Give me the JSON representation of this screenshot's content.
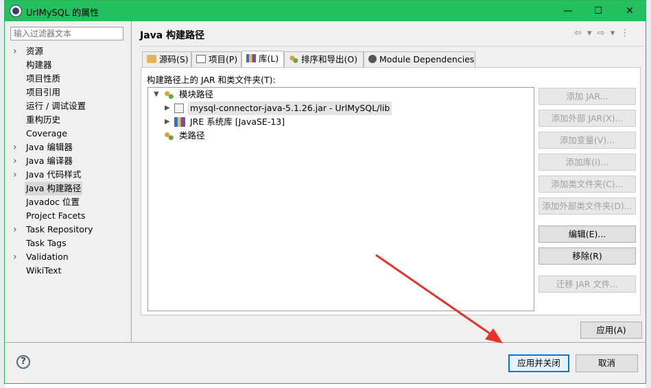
{
  "window": {
    "title": "UrlMySQL 的属性",
    "controls": [
      "—",
      "☐",
      "✕"
    ]
  },
  "filter": {
    "placeholder": "输入过滤器文本"
  },
  "sidebar": {
    "items": [
      {
        "label": "资源",
        "expandable": true
      },
      {
        "label": "构建器",
        "expandable": false
      },
      {
        "label": "项目性质",
        "expandable": false
      },
      {
        "label": "项目引用",
        "expandable": false
      },
      {
        "label": "运行 / 调试设置",
        "expandable": false
      },
      {
        "label": "重构历史",
        "expandable": false
      },
      {
        "label": "Coverage",
        "expandable": false
      },
      {
        "label": "Java 编辑器",
        "expandable": true
      },
      {
        "label": "Java 编译器",
        "expandable": true
      },
      {
        "label": "Java 代码样式",
        "expandable": true
      },
      {
        "label": "Java 构建路径",
        "expandable": false,
        "selected": true
      },
      {
        "label": "Javadoc 位置",
        "expandable": false
      },
      {
        "label": "Project Facets",
        "expandable": false
      },
      {
        "label": "Task Repository",
        "expandable": true
      },
      {
        "label": "Task Tags",
        "expandable": false
      },
      {
        "label": "Validation",
        "expandable": true
      },
      {
        "label": "WikiText",
        "expandable": false
      }
    ]
  },
  "page": {
    "title": "Java 构建路径",
    "nav": "⇦ ▾ ⇨ ▾ ⋮"
  },
  "tabs": [
    {
      "label": "源码(S)",
      "icon": "source-folder-icon"
    },
    {
      "label": "项目(P)",
      "icon": "project-icon"
    },
    {
      "label": "库(L)",
      "icon": "library-icon",
      "active": true
    },
    {
      "label": "排序和导出(O)",
      "icon": "order-export-icon"
    },
    {
      "label": "Module Dependencies",
      "icon": "module-icon"
    }
  ],
  "libraries": {
    "label": "构建路径上的 JAR 和类文件夹(T):",
    "tree": {
      "modulepath": "模块路径",
      "jar": "mysql-connector-java-5.1.26.jar  -  UrlMySQL/lib",
      "jre": "JRE 系统库 [JavaSE-13]",
      "classpath": "类路径"
    }
  },
  "buttons": {
    "add_jar": "添加 JAR...",
    "add_external_jar": "添加外部 JAR(X)...",
    "add_variable": "添加变量(V)...",
    "add_library": "添加库(i)...",
    "add_class_folder": "添加类文件夹(C)...",
    "add_external_class_folder": "添加外部类文件夹(D)...",
    "edit": "编辑(E)...",
    "remove": "移除(R)",
    "migrate_jar": "迁移 JAR 文件...",
    "apply": "应用(A)",
    "apply_close": "应用并关闭",
    "cancel": "取消"
  },
  "colors": {
    "titlebar": "#22c05e",
    "annotation_arrow": "#e8322c",
    "focus": "#0078d7"
  }
}
